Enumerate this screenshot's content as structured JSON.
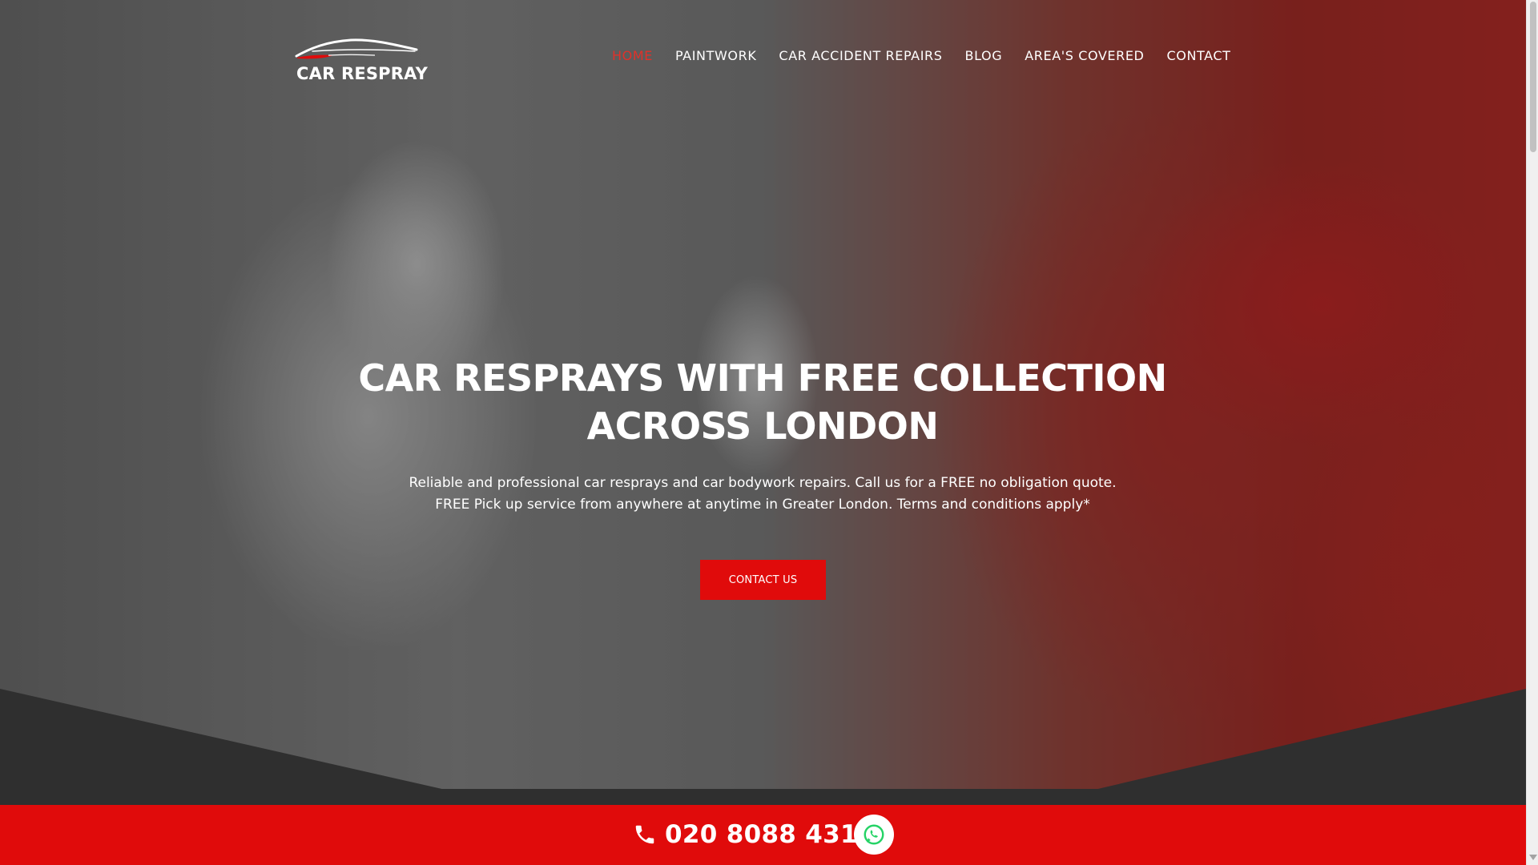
{
  "brand": {
    "name": "CAR RESPRAY",
    "accent_color": "#e00b0b",
    "nav_active_color": "#e0312a"
  },
  "nav": {
    "items": [
      {
        "label": "HOME",
        "active": true
      },
      {
        "label": "PAINTWORK",
        "active": false
      },
      {
        "label": "CAR ACCIDENT REPAIRS",
        "active": false
      },
      {
        "label": "BLOG",
        "active": false
      },
      {
        "label": "AREA'S COVERED",
        "active": false
      },
      {
        "label": "CONTACT",
        "active": false
      }
    ]
  },
  "hero": {
    "title_line1": "CAR RESPRAYS WITH FREE COLLECTION",
    "title_line2": "ACROSS LONDON",
    "subtitle_line1": "Reliable and professional car resprays and car bodywork repairs. Call us for a FREE no obligation quote.",
    "subtitle_line2": "FREE Pick up service from anywhere at anytime in Greater London. Terms and conditions apply*",
    "cta_label": "CONTACT US"
  },
  "call_bar": {
    "phone_number": "020 8088 4319",
    "phone_icon": "phone-icon",
    "whatsapp_icon": "whatsapp-icon"
  }
}
